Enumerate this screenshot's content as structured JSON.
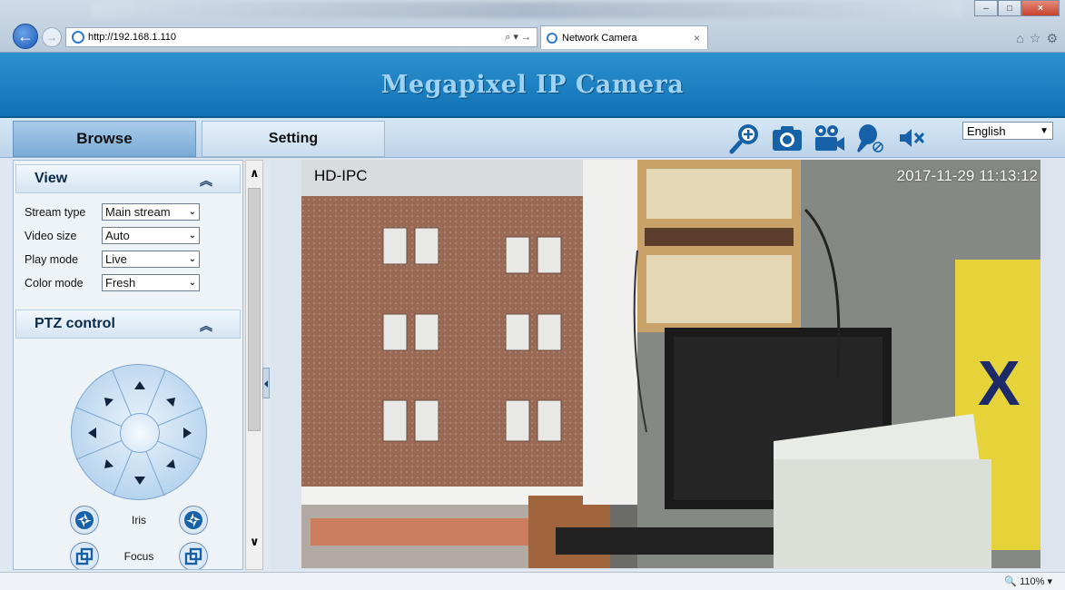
{
  "browser": {
    "address": "http://192.168.1.110",
    "address_tools": "⌕ ▾ →",
    "tab_title": "Network Camera",
    "tab_close": "×",
    "zoom": "110%"
  },
  "page": {
    "banner_title": "Megapixel IP Camera",
    "nav": {
      "browse": "Browse",
      "setting": "Setting"
    },
    "language": "English"
  },
  "view": {
    "title": "View",
    "fields": [
      {
        "label": "Stream type",
        "value": "Main stream"
      },
      {
        "label": "Video size",
        "value": "Auto"
      },
      {
        "label": "Play mode",
        "value": "Live"
      },
      {
        "label": "Color mode",
        "value": "Fresh"
      }
    ]
  },
  "ptz": {
    "title": "PTZ control",
    "iris_label": "Iris",
    "focus_label": "Focus"
  },
  "video": {
    "camera_name": "HD-IPC",
    "timestamp": "2017-11-29  11:13:12"
  },
  "colors": {
    "banner": "#1a7fc1",
    "banner_text": "#9fd3f5",
    "icon_blue": "#1761a8"
  },
  "icons": [
    "zoom-in-icon",
    "snapshot-icon",
    "record-icon",
    "microphone-icon",
    "mute-icon",
    "chevron-up-icon"
  ]
}
